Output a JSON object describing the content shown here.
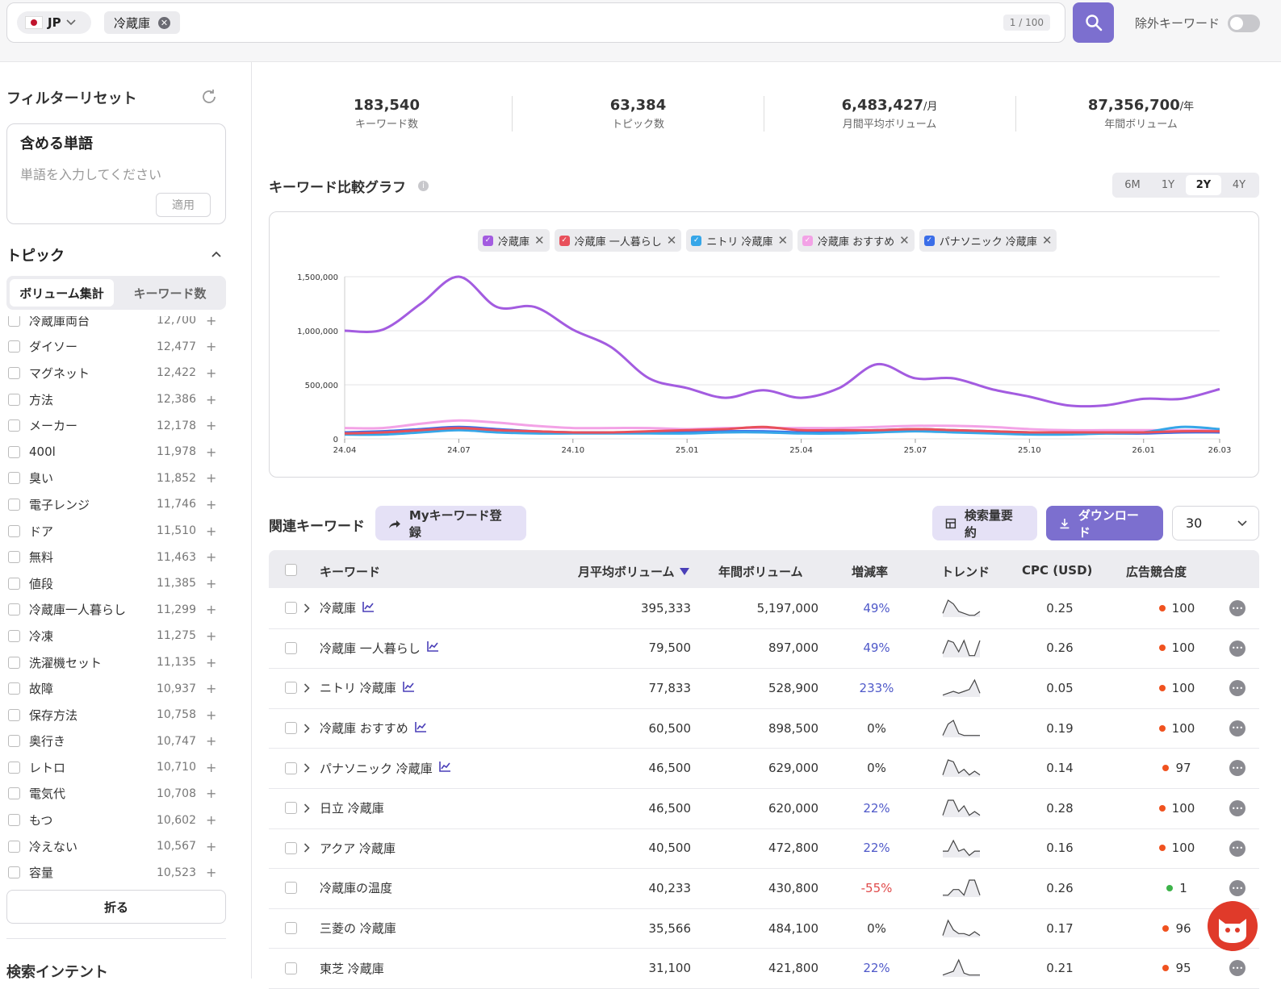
{
  "search": {
    "country": "JP",
    "keyword_chip": "冷蔵庫",
    "counter": "1 / 100",
    "exclude_label": "除外キーワード"
  },
  "sidebar": {
    "filter_reset": "フィルターリセット",
    "include_title": "含める単語",
    "include_placeholder": "単語を入力してください",
    "apply": "適用",
    "topic_title": "トピック",
    "tab_volume": "ボリューム集計",
    "tab_count": "キーワード数",
    "topics": [
      {
        "label": "冷蔵庫両台",
        "value": "12,700"
      },
      {
        "label": "ダイソー",
        "value": "12,477"
      },
      {
        "label": "マグネット",
        "value": "12,422"
      },
      {
        "label": "方法",
        "value": "12,386"
      },
      {
        "label": "メーカー",
        "value": "12,178"
      },
      {
        "label": "400l",
        "value": "11,978"
      },
      {
        "label": "臭い",
        "value": "11,852"
      },
      {
        "label": "電子レンジ",
        "value": "11,746"
      },
      {
        "label": "ドア",
        "value": "11,510"
      },
      {
        "label": "無料",
        "value": "11,463"
      },
      {
        "label": "値段",
        "value": "11,385"
      },
      {
        "label": "冷蔵庫一人暮らし",
        "value": "11,299"
      },
      {
        "label": "冷凍",
        "value": "11,275"
      },
      {
        "label": "洗濯機セット",
        "value": "11,135"
      },
      {
        "label": "故障",
        "value": "10,937"
      },
      {
        "label": "保存方法",
        "value": "10,758"
      },
      {
        "label": "奥行き",
        "value": "10,747"
      },
      {
        "label": "レトロ",
        "value": "10,710"
      },
      {
        "label": "電気代",
        "value": "10,708"
      },
      {
        "label": "もつ",
        "value": "10,602"
      },
      {
        "label": "冷えない",
        "value": "10,567"
      },
      {
        "label": "容量",
        "value": "10,523"
      }
    ],
    "fold": "折る",
    "bottom_title": "検索インテント"
  },
  "stats": [
    {
      "value": "183,540",
      "unit": "",
      "label": "キーワード数"
    },
    {
      "value": "63,384",
      "unit": "",
      "label": "トピック数"
    },
    {
      "value": "6,483,427",
      "unit": "/月",
      "label": "月間平均ボリューム"
    },
    {
      "value": "87,356,700",
      "unit": "/年",
      "label": "年間ボリューム"
    }
  ],
  "graph": {
    "title": "キーワード比較グラフ",
    "periods": [
      "6M",
      "1Y",
      "2Y",
      "4Y"
    ],
    "active_period": "2Y"
  },
  "chart_data": {
    "type": "line",
    "x": [
      "24.04",
      "24.05",
      "24.06",
      "24.07",
      "24.08",
      "24.09",
      "24.10",
      "24.11",
      "24.12",
      "25.01",
      "25.02",
      "25.03",
      "25.04",
      "25.05",
      "25.06",
      "25.07",
      "25.08",
      "25.09",
      "25.10",
      "25.11",
      "25.12",
      "26.01",
      "26.02",
      "26.03"
    ],
    "x_ticks": [
      "24.04",
      "24.07",
      "24.10",
      "25.01",
      "25.04",
      "25.07",
      "25.10",
      "26.01",
      "26.03"
    ],
    "y_ticks": [
      "0",
      "500,000",
      "1,000,000",
      "1,500,000"
    ],
    "ylim": [
      0,
      1500000
    ],
    "grid": true,
    "series": [
      {
        "name": "冷蔵庫",
        "color": "#a35ce0",
        "values": [
          1000000,
          1010000,
          1250000,
          1500000,
          1220000,
          1220000,
          1010000,
          850000,
          560000,
          470000,
          380000,
          450000,
          380000,
          470000,
          690000,
          560000,
          560000,
          460000,
          390000,
          310000,
          310000,
          370000,
          370000,
          460000
        ]
      },
      {
        "name": "冷蔵庫 一人暮らし",
        "color": "#e8505b",
        "values": [
          50000,
          60000,
          80000,
          100000,
          80000,
          70000,
          60000,
          60000,
          70000,
          80000,
          90000,
          110000,
          80000,
          80000,
          80000,
          90000,
          80000,
          70000,
          60000,
          60000,
          60000,
          60000,
          70000,
          70000
        ]
      },
      {
        "name": "ニトリ 冷蔵庫",
        "color": "#36a6e8",
        "values": [
          40000,
          40000,
          60000,
          80000,
          60000,
          50000,
          50000,
          50000,
          50000,
          50000,
          60000,
          60000,
          50000,
          50000,
          60000,
          70000,
          60000,
          50000,
          40000,
          40000,
          50000,
          60000,
          110000,
          90000
        ]
      },
      {
        "name": "冷蔵庫 おすすめ",
        "color": "#f3a2e6",
        "values": [
          100000,
          100000,
          140000,
          170000,
          150000,
          120000,
          100000,
          100000,
          100000,
          90000,
          100000,
          100000,
          100000,
          100000,
          110000,
          120000,
          120000,
          110000,
          90000,
          80000,
          80000,
          80000,
          80000,
          80000
        ]
      },
      {
        "name": "パナソニック 冷蔵庫",
        "color": "#3b6ee8",
        "values": [
          60000,
          70000,
          90000,
          110000,
          90000,
          70000,
          60000,
          60000,
          60000,
          60000,
          70000,
          70000,
          60000,
          70000,
          80000,
          90000,
          80000,
          70000,
          60000,
          50000,
          50000,
          50000,
          60000,
          60000
        ]
      }
    ]
  },
  "related": {
    "title": "関連キーワード",
    "my_kw": "Myキーワード登録",
    "summary": "検索量要約",
    "download": "ダウンロード",
    "per_page": "30",
    "headers": {
      "keyword": "キーワード",
      "monthly": "月平均ボリューム",
      "yearly": "年間ボリューム",
      "growth": "増減率",
      "trend": "トレンド",
      "cpc": "CPC (USD)",
      "competition": "広告競合度"
    },
    "rows": [
      {
        "kw": "冷蔵庫",
        "expand": true,
        "chart": true,
        "monthly": "395,333",
        "yearly": "5,197,000",
        "growth": "49%",
        "gclass": "blue",
        "cpc": "0.25",
        "comp": "100",
        "dot": "#f0521f",
        "trend": [
          2,
          9,
          7,
          3,
          2,
          1,
          1,
          3
        ]
      },
      {
        "kw": "冷蔵庫 一人暮らし",
        "expand": false,
        "chart": true,
        "monthly": "79,500",
        "yearly": "897,000",
        "growth": "49%",
        "gclass": "blue",
        "cpc": "0.26",
        "comp": "100",
        "dot": "#f0521f",
        "trend": [
          2,
          9,
          8,
          3,
          9,
          1,
          1,
          9
        ]
      },
      {
        "kw": "ニトリ 冷蔵庫",
        "expand": true,
        "chart": true,
        "monthly": "77,833",
        "yearly": "528,900",
        "growth": "233%",
        "gclass": "blue",
        "cpc": "0.05",
        "comp": "100",
        "dot": "#f0521f",
        "trend": [
          1,
          2,
          3,
          2,
          3,
          4,
          9,
          2
        ]
      },
      {
        "kw": "冷蔵庫 おすすめ",
        "expand": true,
        "chart": true,
        "monthly": "60,500",
        "yearly": "898,500",
        "growth": "0%",
        "gclass": "",
        "cpc": "0.19",
        "comp": "100",
        "dot": "#f0521f",
        "trend": [
          1,
          7,
          9,
          2,
          1,
          1,
          1,
          1
        ]
      },
      {
        "kw": "パナソニック 冷蔵庫",
        "expand": true,
        "chart": true,
        "monthly": "46,500",
        "yearly": "629,000",
        "growth": "0%",
        "gclass": "",
        "cpc": "0.14",
        "comp": "97",
        "dot": "#f0521f",
        "trend": [
          1,
          9,
          8,
          2,
          4,
          1,
          3,
          1
        ]
      },
      {
        "kw": "日立 冷蔵庫",
        "expand": true,
        "chart": false,
        "monthly": "46,500",
        "yearly": "620,000",
        "growth": "22%",
        "gclass": "blue",
        "cpc": "0.28",
        "comp": "100",
        "dot": "#f0521f",
        "trend": [
          1,
          9,
          9,
          3,
          6,
          1,
          3,
          1
        ]
      },
      {
        "kw": "アクア 冷蔵庫",
        "expand": true,
        "chart": false,
        "monthly": "40,500",
        "yearly": "472,800",
        "growth": "22%",
        "gclass": "blue",
        "cpc": "0.16",
        "comp": "100",
        "dot": "#f0521f",
        "trend": [
          3,
          3,
          8,
          3,
          4,
          1,
          3,
          3
        ]
      },
      {
        "kw": "冷蔵庫の温度",
        "expand": false,
        "chart": false,
        "monthly": "40,233",
        "yearly": "430,800",
        "growth": "-55%",
        "gclass": "red",
        "cpc": "0.26",
        "comp": "1",
        "dot": "#3db34a",
        "trend": [
          1,
          1,
          4,
          4,
          1,
          9,
          9,
          1
        ]
      },
      {
        "kw": "三菱の 冷蔵庫",
        "expand": false,
        "chart": false,
        "monthly": "35,566",
        "yearly": "484,100",
        "growth": "0%",
        "gclass": "",
        "cpc": "0.17",
        "comp": "96",
        "dot": "#f0521f",
        "trend": [
          1,
          9,
          4,
          2,
          2,
          1,
          3,
          1
        ]
      },
      {
        "kw": "東芝 冷蔵庫",
        "expand": false,
        "chart": false,
        "monthly": "31,100",
        "yearly": "421,800",
        "growth": "22%",
        "gclass": "blue",
        "cpc": "0.21",
        "comp": "95",
        "dot": "#f0521f",
        "trend": [
          1,
          2,
          3,
          9,
          2,
          1,
          1,
          1
        ]
      }
    ]
  }
}
